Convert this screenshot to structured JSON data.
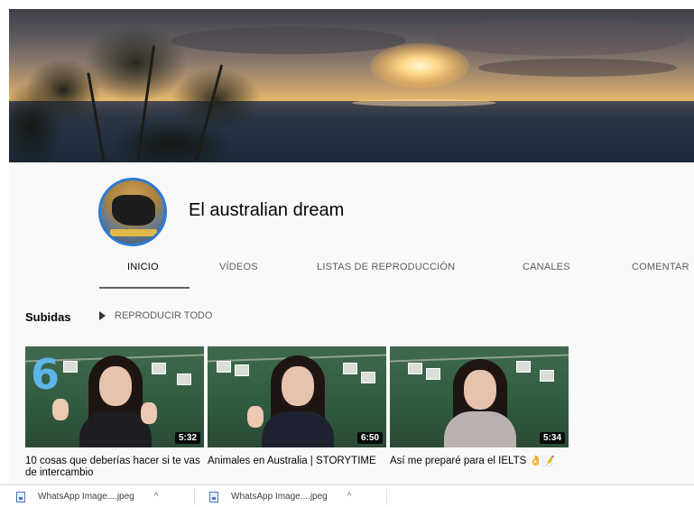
{
  "channel": {
    "name": "El australian dream"
  },
  "tabs": [
    {
      "label": "INICIO",
      "active": true
    },
    {
      "label": "VÍDEOS",
      "active": false
    },
    {
      "label": "LISTAS DE REPRODUCCIÓN",
      "active": false
    },
    {
      "label": "CANALES",
      "active": false
    },
    {
      "label": "COMENTAR",
      "active": false
    }
  ],
  "section": {
    "title": "Subidas",
    "play_all": "REPRODUCIR TODO",
    "play_icon": "play-icon"
  },
  "videos": [
    {
      "title": "10 cosas que deberías hacer si te vas de intercambio",
      "duration": "5:32"
    },
    {
      "title": "Animales en Australia | STORYTIME",
      "duration": "6:50"
    },
    {
      "title": "Así me preparé para el IELTS 👌📝",
      "duration": "5:34"
    }
  ],
  "downloads": [
    {
      "filename": "WhatsApp Image....jpeg",
      "icon": "file-icon",
      "caret": "^"
    },
    {
      "filename": "WhatsApp Image....jpeg",
      "icon": "file-icon",
      "caret": "^"
    }
  ],
  "colors": {
    "avatar_border": "#2b7bd2",
    "header_bg": "#f9f9f9",
    "duration_bg": "#000000"
  }
}
